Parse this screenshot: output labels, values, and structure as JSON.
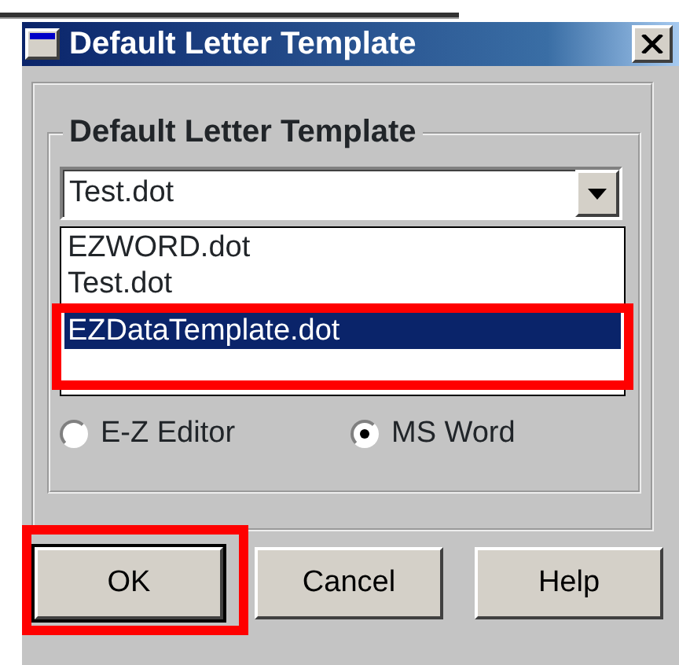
{
  "window": {
    "title": "Default Letter Template"
  },
  "group": {
    "label": "Default Letter Template"
  },
  "combo": {
    "value": "Test.dot"
  },
  "list_items": [
    {
      "label": "EZWORD.dot",
      "selected": false,
      "highlighted": false
    },
    {
      "label": "Test.dot",
      "selected": false,
      "highlighted": false
    },
    {
      "label": "EZDataTemplate.dot",
      "selected": true,
      "highlighted": true
    }
  ],
  "editors": [
    {
      "label": "E-Z Editor",
      "selected": false
    },
    {
      "label": "MS Word",
      "selected": true
    }
  ],
  "buttons": [
    {
      "label": "OK",
      "default": true,
      "highlighted": true
    },
    {
      "label": "Cancel",
      "default": false,
      "highlighted": false
    },
    {
      "label": "Help",
      "default": false,
      "highlighted": false
    }
  ]
}
